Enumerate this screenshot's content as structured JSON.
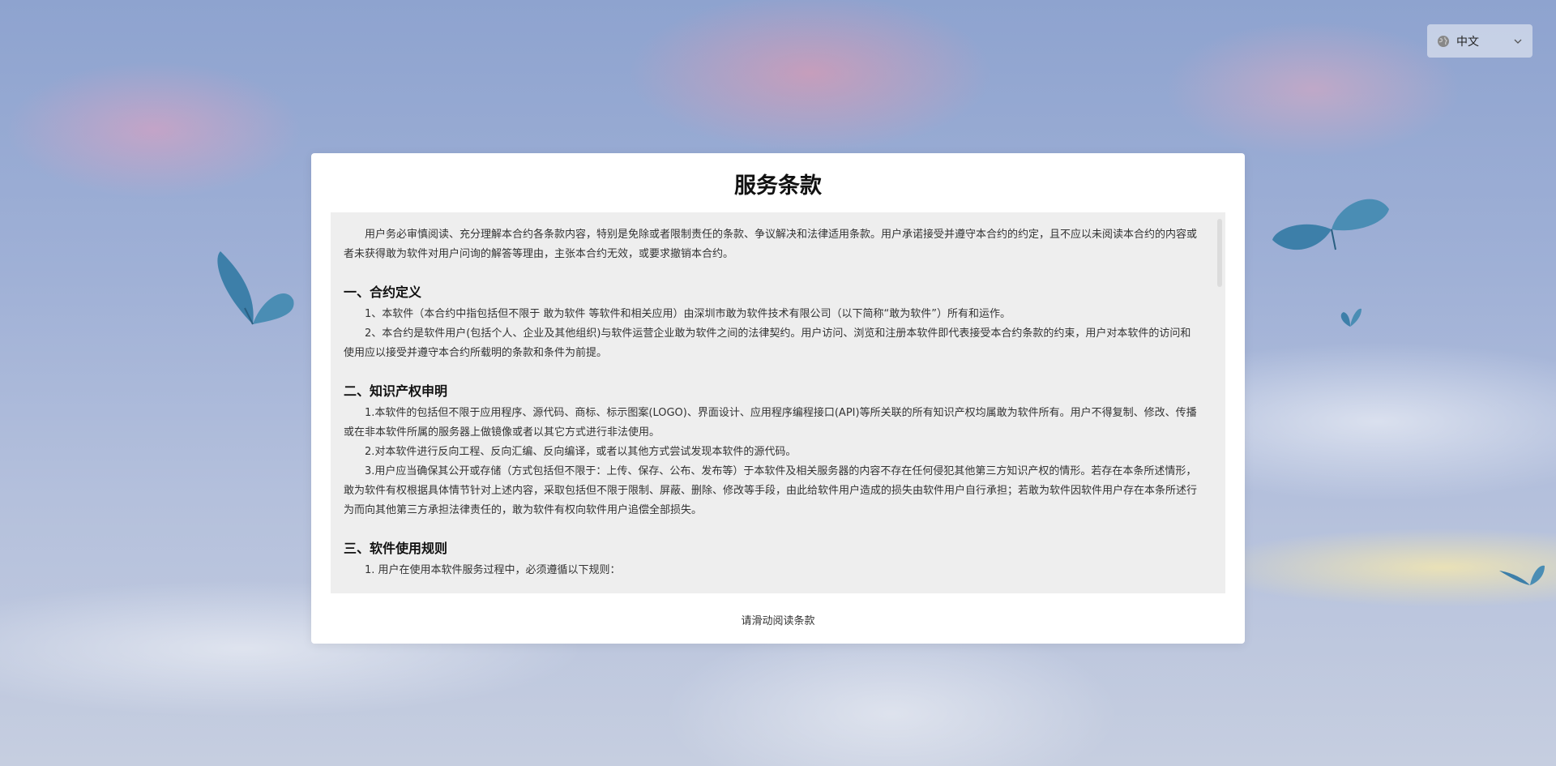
{
  "language": {
    "selected": "中文"
  },
  "dialog": {
    "title": "服务条款",
    "intro": "用户务必审慎阅读、充分理解本合约各条款内容，特别是免除或者限制责任的条款、争议解决和法律适用条款。用户承诺接受并遵守本合约的约定，且不应以未阅读本合约的内容或者未获得敢为软件对用户问询的解答等理由，主张本合约无效，或要求撤销本合约。",
    "sections": [
      {
        "heading": "一、合约定义",
        "paragraphs": [
          "1、本软件（本合约中指包括但不限于 敢为软件 等软件和相关应用）由深圳市敢为软件技术有限公司（以下简称“敢为软件”）所有和运作。",
          "2、本合约是软件用户(包括个人、企业及其他组织)与软件运营企业敢为软件之间的法律契约。用户访问、浏览和注册本软件即代表接受本合约条款的约束，用户对本软件的访问和使用应以接受并遵守本合约所载明的条款和条件为前提。"
        ]
      },
      {
        "heading": "二、知识产权申明",
        "paragraphs": [
          "1.本软件的包括但不限于应用程序、源代码、商标、标示图案(LOGO)、界面设计、应用程序编程接口(API)等所关联的所有知识产权均属敢为软件所有。用户不得复制、修改、传播或在非本软件所属的服务器上做镜像或者以其它方式进行非法使用。",
          "2.对本软件进行反向工程、反向汇编、反向编译，或者以其他方式尝试发现本软件的源代码。",
          "3.用户应当确保其公开或存储（方式包括但不限于：上传、保存、公布、发布等）于本软件及相关服务器的内容不存在任何侵犯其他第三方知识产权的情形。若存在本条所述情形，敢为软件有权根据具体情节针对上述内容，采取包括但不限于限制、屏蔽、删除、修改等手段，由此给软件用户造成的损失由软件用户自行承担；若敢为软件因软件用户存在本条所述行为而向其他第三方承担法律责任的，敢为软件有权向软件用户追偿全部损失。"
        ]
      },
      {
        "heading": "三、软件使用规则",
        "paragraphs": [
          "1. 用户在使用本软件服务过程中，必须遵循以下规则："
        ]
      }
    ],
    "scroll_hint": "请滑动阅读条款"
  },
  "colors": {
    "accent": "#3b7ca8",
    "panel_bg": "#eeeeee"
  },
  "icons": {
    "language": "globe-icon",
    "dropdown": "chevron-down-icon",
    "decor": "butterfly-icon"
  }
}
